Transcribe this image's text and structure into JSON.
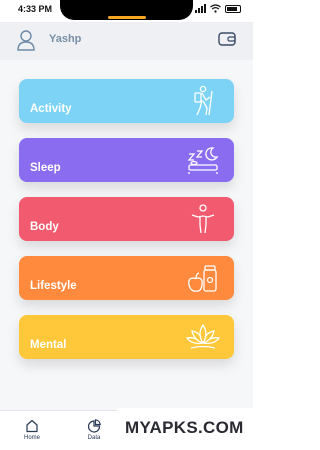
{
  "status_bar": {
    "time": "4:33 PM"
  },
  "header": {
    "username": "Yashp"
  },
  "cards": [
    {
      "label": "Activity",
      "color": "#7dd3f5",
      "icon": "hiker-icon"
    },
    {
      "label": "Sleep",
      "color": "#8a6cf0",
      "icon": "sleep-bed-icon"
    },
    {
      "label": "Body",
      "color": "#f25a70",
      "icon": "body-stretch-icon"
    },
    {
      "label": "Lifestyle",
      "color": "#ff8a3d",
      "icon": "apple-jar-icon"
    },
    {
      "label": "Mental",
      "color": "#ffc83a",
      "icon": "lotus-icon"
    }
  ],
  "nav": {
    "home": "Home",
    "data": "Data"
  },
  "watermark": {
    "text": "MYAPKS.COM"
  }
}
